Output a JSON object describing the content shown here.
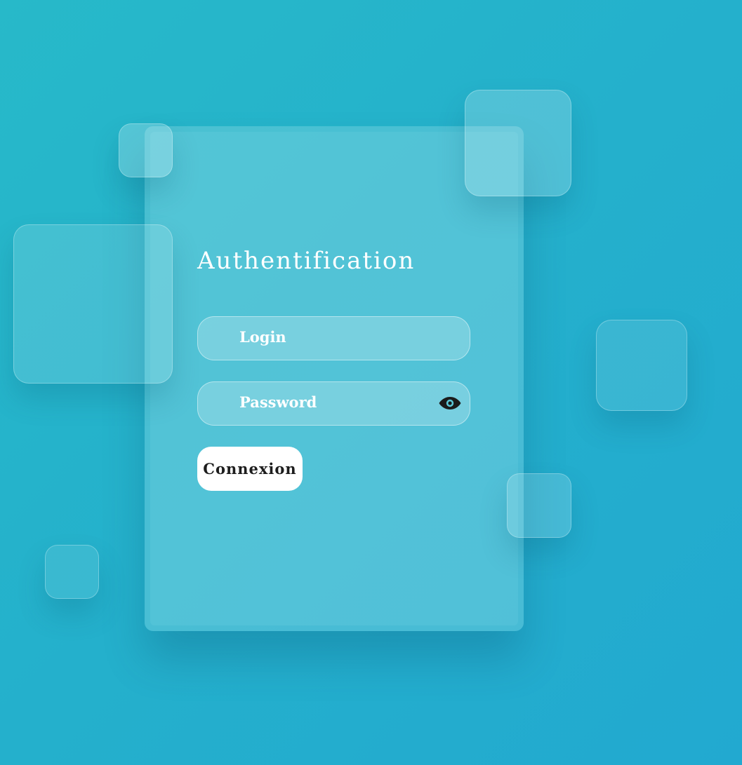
{
  "form": {
    "title": "Authentification",
    "login_placeholder": "Login",
    "password_placeholder": "Password",
    "password_toggle_icon": "eye-icon",
    "submit_label": "Connexion"
  },
  "colors": {
    "background_start": "#27b9c9",
    "background_end": "#22a9d0",
    "text": "#ffffff",
    "button_bg": "#ffffff",
    "button_text": "#1d1d1d",
    "eye_icon": "#1b1b1b"
  }
}
